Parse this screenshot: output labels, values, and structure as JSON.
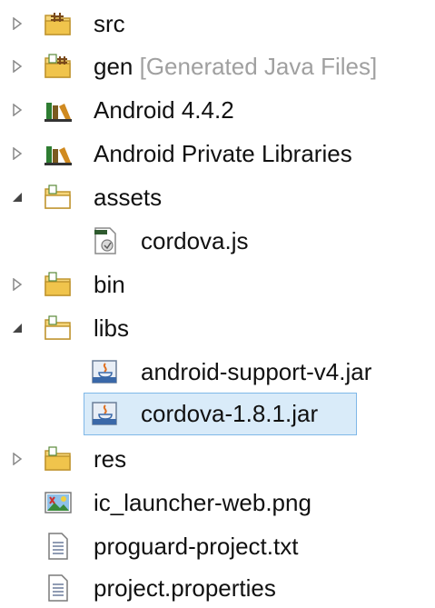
{
  "tree": {
    "items": [
      {
        "label": "src",
        "decoration": "",
        "expanded": false,
        "icon": "source-folder-icon"
      },
      {
        "label": "gen",
        "decoration": " [Generated Java Files]",
        "expanded": false,
        "icon": "source-folder-icon"
      },
      {
        "label": "Android 4.4.2",
        "decoration": "",
        "expanded": false,
        "icon": "library-icon"
      },
      {
        "label": "Android Private Libraries",
        "decoration": "",
        "expanded": false,
        "icon": "library-icon"
      },
      {
        "label": "assets",
        "decoration": "",
        "expanded": true,
        "icon": "folder-icon"
      },
      {
        "label": "cordova.js",
        "decoration": "",
        "icon": "js-file-icon"
      },
      {
        "label": "bin",
        "decoration": "",
        "expanded": false,
        "icon": "folder-icon"
      },
      {
        "label": "libs",
        "decoration": "",
        "expanded": true,
        "icon": "folder-icon"
      },
      {
        "label": "android-support-v4.jar",
        "decoration": "",
        "icon": "jar-icon"
      },
      {
        "label": "cordova-1.8.1.jar",
        "decoration": "",
        "icon": "jar-icon",
        "selected": true
      },
      {
        "label": "res",
        "decoration": "",
        "expanded": false,
        "icon": "folder-icon"
      },
      {
        "label": "ic_launcher-web.png",
        "decoration": "",
        "icon": "image-file-icon"
      },
      {
        "label": "proguard-project.txt",
        "decoration": "",
        "icon": "text-file-icon"
      },
      {
        "label": "project.properties",
        "decoration": "",
        "icon": "text-file-icon"
      }
    ]
  },
  "colors": {
    "selection_bg": "#d9ebf9",
    "selection_border": "#7fb8e8",
    "decoration_text": "#a0a0a0",
    "folder_yellow": "#f0c44c"
  }
}
